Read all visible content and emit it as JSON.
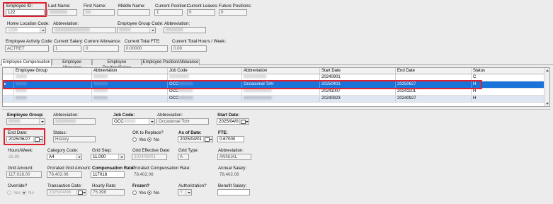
{
  "header": {
    "employee_id_label": "Employee ID:",
    "employee_id_value": "122",
    "last_name_label": "Last Name:",
    "first_name_label": "First Name:",
    "middle_name_label": "Middle Name:",
    "current_position_label": "Current Position:",
    "current_position_value": "1",
    "current_leaves_label": "Current Leaves:",
    "current_leaves_value": "0",
    "future_positions_label": "Future Positions:",
    "future_positions_value": "0",
    "home_location_label": "Home Location Code:",
    "abbreviation_label": "Abbreviation:",
    "employee_group_code_label": "Employee Group Code:",
    "abbreviation2_label": "Abbreviation:",
    "activity_code_label": "Employee Activity Code:",
    "activity_code_value": "ACTRET",
    "current_salary_label": "Current Salary:",
    "current_salary_value": "1",
    "current_allowance_label": "Current Allowance:",
    "current_allowance_value": "0",
    "current_total_fte_label": "Current Total FTE:",
    "current_total_fte_value": "0.00000",
    "current_total_hours_label": "Current Total Hours / Week:",
    "current_total_hours_value": "0.00"
  },
  "tabs": [
    {
      "label": "Employee Compensation",
      "active": true
    },
    {
      "label": "Employee Allowance"
    },
    {
      "label": "Employee Position/Salary"
    },
    {
      "label": "Employee Position/Allowance"
    }
  ],
  "grid": {
    "columns": [
      "Employee Group",
      "Abbreviation",
      "Job Code",
      "Abbreviation",
      "Start Date",
      "End Date",
      "Status"
    ],
    "rows": [
      {
        "group": "",
        "abbr": "",
        "job": "",
        "job_abbr": "",
        "start": "20240901",
        "end": "",
        "status": "C"
      },
      {
        "group": "",
        "abbr": "",
        "job": "OCC",
        "job_abbr": "Occasional Tchr",
        "start": "20250401",
        "end": "20250627",
        "status": "H"
      },
      {
        "group": "",
        "abbr": "",
        "job": "OCC",
        "job_abbr": "",
        "start": "20241007",
        "end": "20241101",
        "status": "H"
      },
      {
        "group": "",
        "abbr": "",
        "job": "OCC",
        "job_abbr": "",
        "start": "20240923",
        "end": "20240927",
        "status": "H"
      }
    ]
  },
  "detail": {
    "employee_group_label": "Employee Group:",
    "abbreviation_label": "Abbreviation:",
    "job_code_label": "Job Code:",
    "job_code_value": "OCC",
    "job_abbreviation_label": "Abbreviation:",
    "job_abbreviation_value": "Occasional Tchr",
    "start_date_label": "Start Date:",
    "start_date_value": "2025/04/01",
    "end_date_label": "End Date:",
    "end_date_value": "2025/06/27",
    "status_label": "Status:",
    "status_value": "History",
    "ok_to_replace_label": "OK to Replace?",
    "yes_label": "Yes",
    "no_label": "No",
    "as_of_date_label": "As of Date:",
    "as_of_date_value": "2025/04/01",
    "fte_label": "FTE:",
    "fte_value": "0.67000",
    "hours_week_label": "Hours/Week:",
    "hours_week_value": "26.80",
    "category_code_label": "Category Code:",
    "category_code_value": "A4",
    "grid_step_label": "Grid Step:",
    "grid_step_value": "11.000",
    "grid_effective_date_label": "Grid Effective Date:",
    "grid_effective_date_value": "2024/09/01",
    "grid_type_label": "Grid Type:",
    "grid_type_value": "A",
    "abbreviation3_label": "Abbreviation:",
    "abbreviation3_value": "ANNUAL",
    "grid_amount_label": "Grid Amount:",
    "grid_amount_value": "117,018.00",
    "prorated_grid_amount_label": "Prorated Grid Amount:",
    "prorated_grid_amount_value": "78,402.06",
    "compensation_rate_label": "Compensation Rate:",
    "compensation_rate_value": "117018",
    "prorated_comp_rate_label": "Prorated Compensation Rate:",
    "prorated_comp_rate_value": "78,402.06",
    "annual_salary_label": "Annual Salary:",
    "annual_salary_value": "78,402.06",
    "override_label": "Override?",
    "transaction_date_label": "Transaction Date:",
    "transaction_date_value": "2025/04/08",
    "hourly_rate_label": "Hourly Rate:",
    "hourly_rate_value": "75.398",
    "frozen_label": "Frozen?",
    "authorization_label": "Authorization?",
    "authorization_value": "Y",
    "benefit_salary_label": "Benefit Salary:"
  },
  "colors": {
    "highlight_box": "#e0202c",
    "selected_row": "#1a73d8",
    "alt_row": "#dde6f2"
  }
}
